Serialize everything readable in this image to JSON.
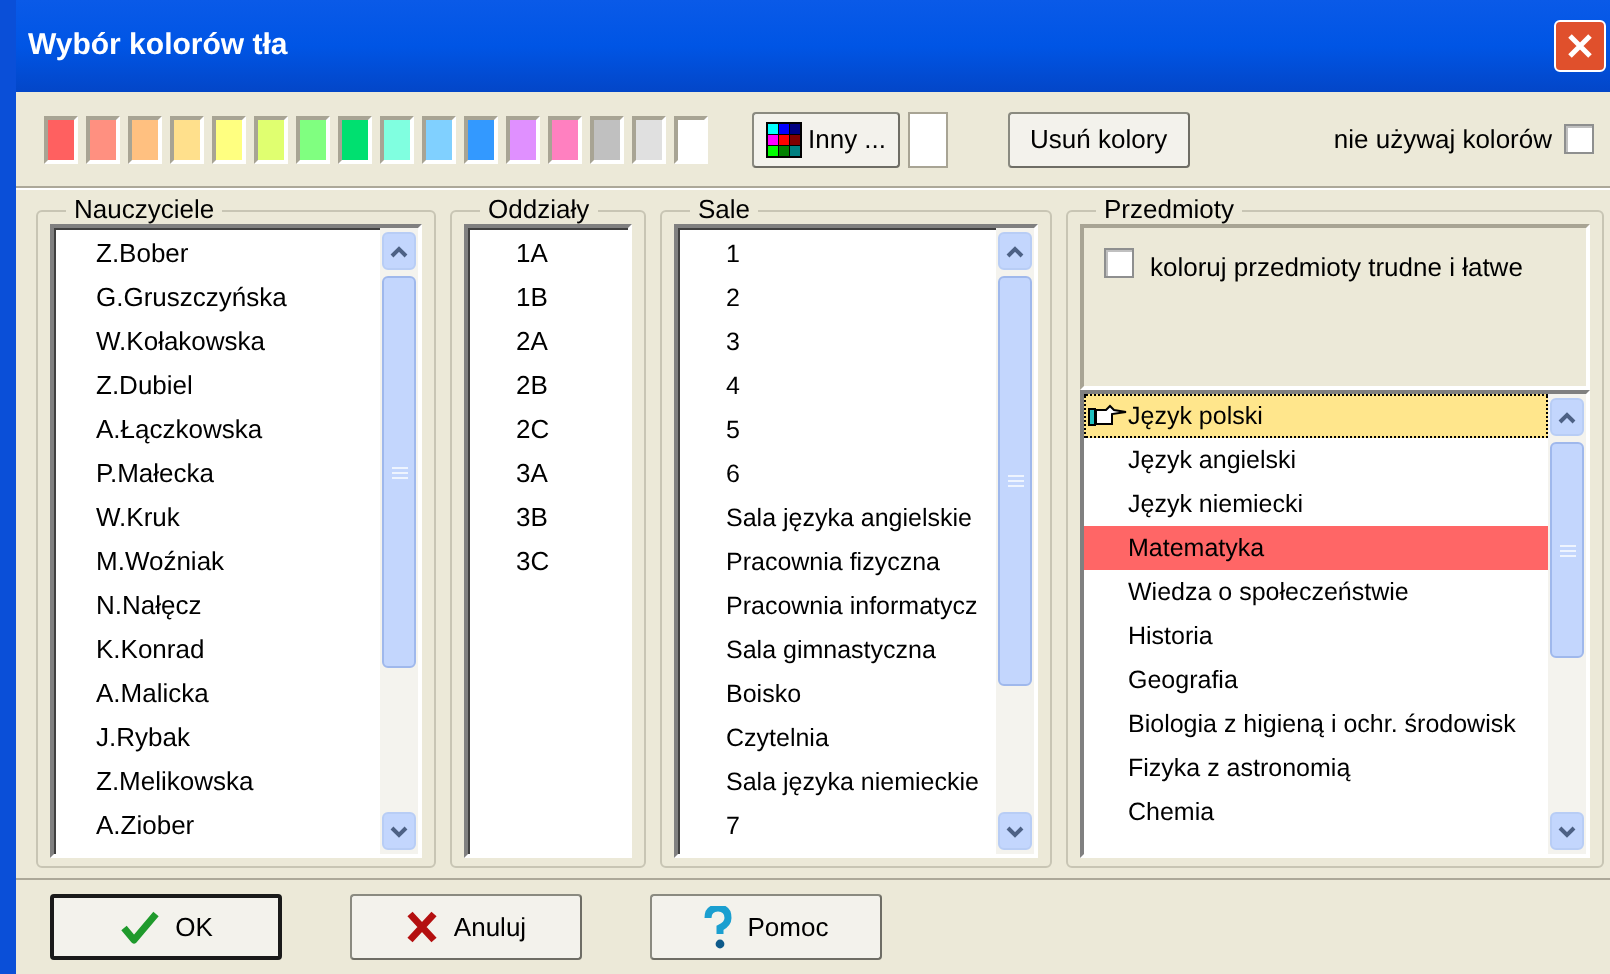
{
  "window": {
    "title": "Wybór kolorów tła"
  },
  "palette": [
    {
      "color": "#ff6060"
    },
    {
      "color": "#ff9080"
    },
    {
      "color": "#ffc080"
    },
    {
      "color": "#ffe08c"
    },
    {
      "color": "#ffff80"
    },
    {
      "color": "#e0ff70"
    },
    {
      "color": "#80ff80"
    },
    {
      "color": "#00e070"
    },
    {
      "color": "#80ffe0"
    },
    {
      "color": "#80d0ff"
    },
    {
      "color": "#3399ff"
    },
    {
      "color": "#e090ff"
    },
    {
      "color": "#ff80c0"
    },
    {
      "color": "#c0c0c0"
    },
    {
      "color": "#e0e0e0"
    },
    {
      "color": "#ffffff"
    }
  ],
  "other_button": {
    "label": "Inny ..."
  },
  "remove_button": {
    "label": "Usuń kolory"
  },
  "no_colors": {
    "label": "nie używaj kolorów",
    "checked": false
  },
  "teachers": {
    "title": "Nauczyciele",
    "items": [
      "Z.Bober",
      "G.Gruszczyńska",
      "W.Kołakowska",
      "Z.Dubiel",
      "A.Łączkowska",
      "P.Małecka",
      "W.Kruk",
      "M.Woźniak",
      "N.Nałęcz",
      "K.Konrad",
      "A.Malicka",
      "J.Rybak",
      "Z.Melikowska",
      "A.Ziober"
    ]
  },
  "classes": {
    "title": "Oddziały",
    "items": [
      "1A",
      "1B",
      "2A",
      "2B",
      "2C",
      "3A",
      "3B",
      "3C"
    ]
  },
  "rooms": {
    "title": "Sale",
    "items": [
      "1",
      "2",
      "3",
      "4",
      "5",
      "6",
      "Sala języka angielskie",
      "Pracownia fizyczna",
      "Pracownia informatycz",
      "Sala gimnastyczna",
      "Boisko",
      "Czytelnia",
      "Sala języka niemieckie",
      "7"
    ]
  },
  "subjects": {
    "title": "Przedmioty",
    "hard_easy": {
      "label": "koloruj przedmioty trudne i łatwe",
      "checked": false
    },
    "items": [
      {
        "label": "Język polski",
        "selected": true,
        "color": "#ffe68c"
      },
      {
        "label": "Język angielski",
        "selected": false
      },
      {
        "label": "Język niemiecki",
        "selected": false
      },
      {
        "label": "Matematyka",
        "selected": false,
        "color": "#ff6666"
      },
      {
        "label": "Wiedza o społeczeństwie",
        "selected": false
      },
      {
        "label": "Historia",
        "selected": false
      },
      {
        "label": "Geografia",
        "selected": false
      },
      {
        "label": "Biologia z higieną i ochr. środowisk",
        "selected": false
      },
      {
        "label": "Fizyka z astronomią",
        "selected": false
      },
      {
        "label": "Chemia",
        "selected": false
      }
    ]
  },
  "buttons": [
    {
      "kind": "ok",
      "label": "OK",
      "default": true
    },
    {
      "kind": "cancel",
      "label": "Anuluj",
      "default": false
    },
    {
      "kind": "help",
      "label": "Pomoc",
      "default": false
    }
  ]
}
